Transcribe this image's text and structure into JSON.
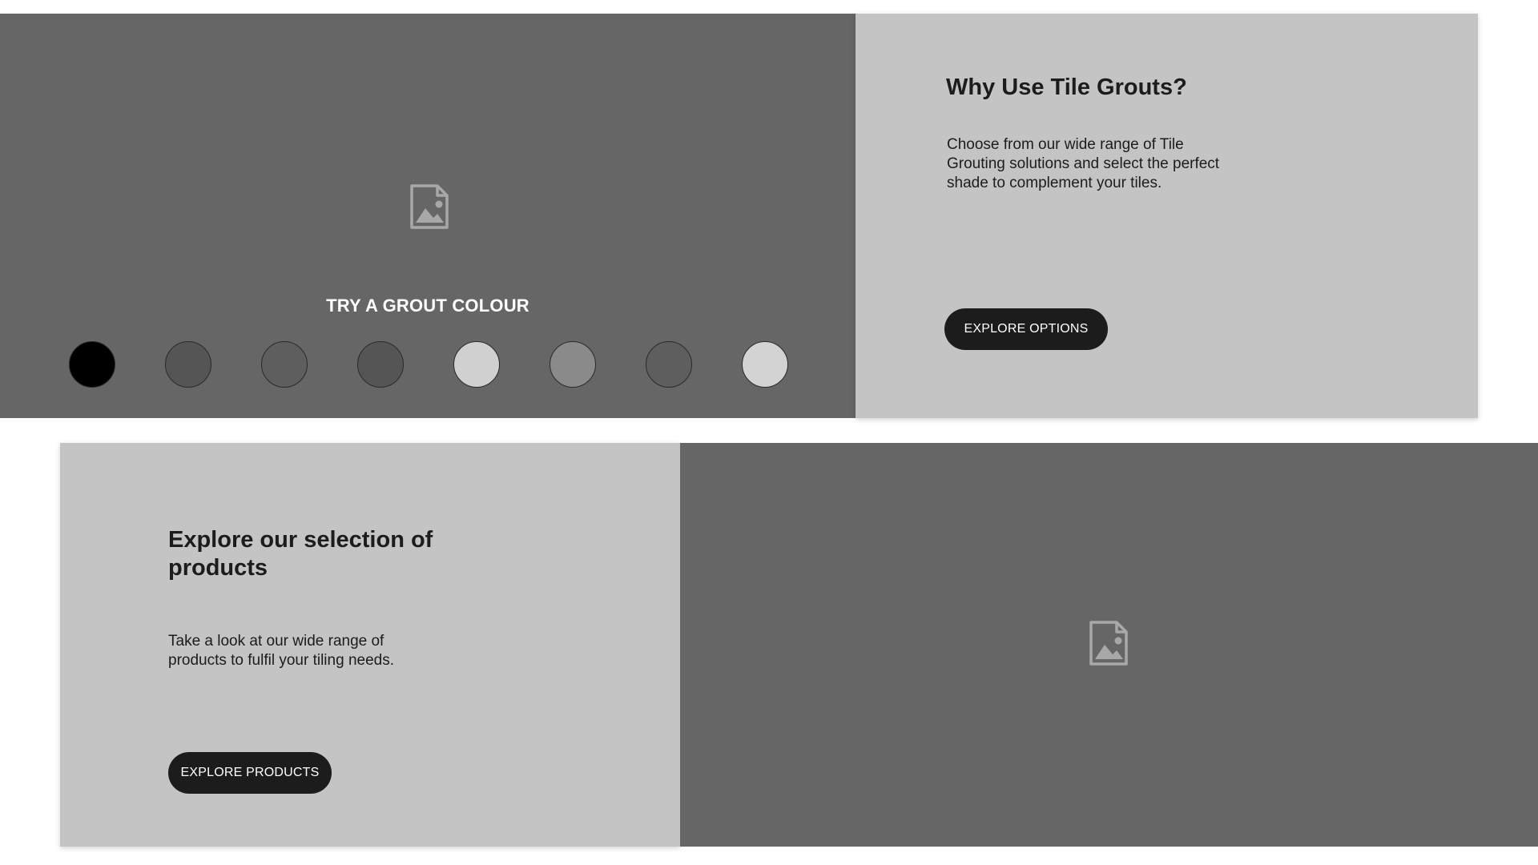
{
  "top_section": {
    "grout_title": "TRY A GROUT COLOUR",
    "swatches": [
      {
        "color": "#000000"
      },
      {
        "color": "#555555"
      },
      {
        "color": "#5e5e5e"
      },
      {
        "color": "#555555"
      },
      {
        "color": "#d0d0d0"
      },
      {
        "color": "#8a8a8a"
      },
      {
        "color": "#5e5e5e"
      },
      {
        "color": "#d3d3d3"
      }
    ],
    "heading": "Why Use Tile Grouts?",
    "body_lines": [
      "Choose from our wide range of Tile",
      "Grouting solutions and select the perfect",
      "shade to complement your tiles."
    ],
    "button_label": "EXPLORE OPTIONS"
  },
  "bottom_section": {
    "heading_lines": [
      "Explore our selection of",
      "products"
    ],
    "body_lines": [
      "Take a look at our wide range of",
      "products to fulfil your tiling needs."
    ],
    "button_label": "EXPLORE PRODUCTS"
  },
  "icons": {
    "image_placeholder": "image-placeholder-icon"
  },
  "colors": {
    "image_panel": "#666666",
    "text_panel": "#c4c4c4",
    "button": "#1c1c1c",
    "placeholder_icon": "#a8a8a8"
  }
}
